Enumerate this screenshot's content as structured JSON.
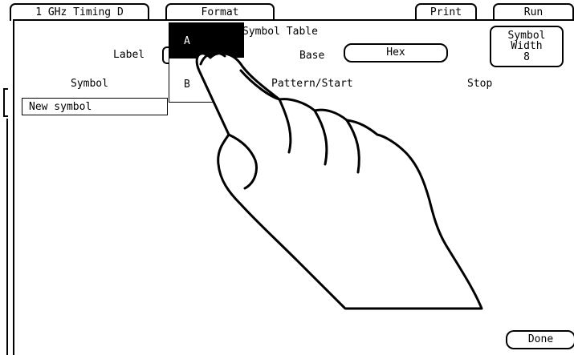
{
  "top_tabs": {
    "analyzer_label": "1 GHz Timing D",
    "format_label": "Format",
    "print_label": "Print",
    "run_label": "Run"
  },
  "dialog": {
    "title": "Symbol Table",
    "label_caption": "Label",
    "label_options": [
      "A",
      "B"
    ],
    "selected_label": "A",
    "base_caption": "Base",
    "base_value": "Hex",
    "symbol_width_line1": "Symbol",
    "symbol_width_line2": "Width",
    "symbol_width_value": "8",
    "columns": {
      "symbol": "Symbol",
      "pattern_start": "Pattern/Start",
      "stop": "Stop"
    },
    "new_symbol_label": "New symbol",
    "done_label": "Done"
  }
}
